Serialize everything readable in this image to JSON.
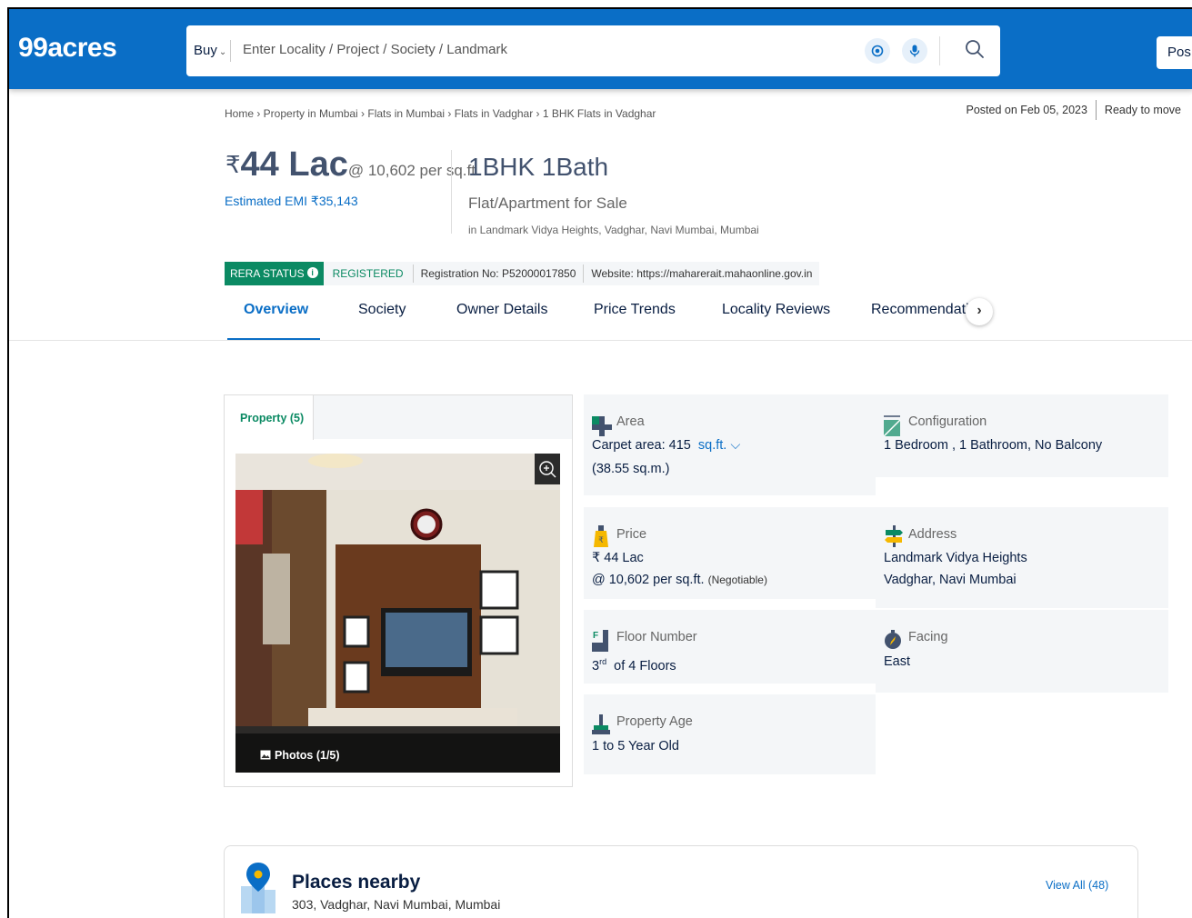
{
  "header": {
    "logo": "99acres",
    "search": {
      "mode": "Buy",
      "placeholder": "Enter Locality / Project / Society / Landmark"
    },
    "post_label": "Pos"
  },
  "breadcrumb": "Home › Property in Mumbai › Flats in Mumbai › Flats in Vadghar › 1 BHK Flats in Vadghar",
  "posted": {
    "date": "Posted on Feb 05, 2023",
    "status": "Ready to move"
  },
  "listing": {
    "currency": "₹",
    "price": "44 Lac",
    "per_sqft": "@ 10,602 per sq.ft.",
    "emi": "Estimated EMI ₹35,143",
    "configuration": "1BHK 1Bath",
    "type": "Flat/Apartment for Sale",
    "location": "in Landmark Vidya Heights, Vadghar, Navi Mumbai, Mumbai"
  },
  "rera": {
    "status_label": "RERA STATUS",
    "status_value": "REGISTERED",
    "registration": "Registration No: P52000017850",
    "website": "Website: https://maharerait.mahaonline.gov.in"
  },
  "tabs": [
    {
      "label": "Overview",
      "active": true
    },
    {
      "label": "Society"
    },
    {
      "label": "Owner Details"
    },
    {
      "label": "Price Trends"
    },
    {
      "label": "Locality Reviews"
    },
    {
      "label": "Recommendati"
    }
  ],
  "gallery": {
    "tab_label": "Property (5)",
    "photos_label": "Photos (1/5)"
  },
  "details": {
    "area": {
      "label": "Area",
      "value": "Carpet area: 415",
      "unit": "sq.ft.",
      "sub": "(38.55 sq.m.)"
    },
    "configuration": {
      "label": "Configuration",
      "value": "1 Bedroom , 1 Bathroom, No Balcony"
    },
    "price": {
      "label": "Price",
      "value": "₹ 44 Lac",
      "per_sqft": "@ 10,602 per sq.ft.",
      "negotiable": "(Negotiable)"
    },
    "address": {
      "label": "Address",
      "line1": "Landmark Vidya Heights",
      "line2": "Vadghar, Navi Mumbai"
    },
    "floor": {
      "label": "Floor Number",
      "floor": "3",
      "suffix": "rd",
      "total": "of 4 Floors"
    },
    "facing": {
      "label": "Facing",
      "value": "East"
    },
    "age": {
      "label": "Property Age",
      "value": "1 to 5 Year Old"
    }
  },
  "places": {
    "title": "Places nearby",
    "address": "303, Vadghar, Navi Mumbai, Mumbai",
    "view_all": "View All (48)"
  },
  "colors": {
    "brand_blue": "#0A6EC6",
    "rera_green": "#0B8A63",
    "text_dark": "#091E42"
  }
}
